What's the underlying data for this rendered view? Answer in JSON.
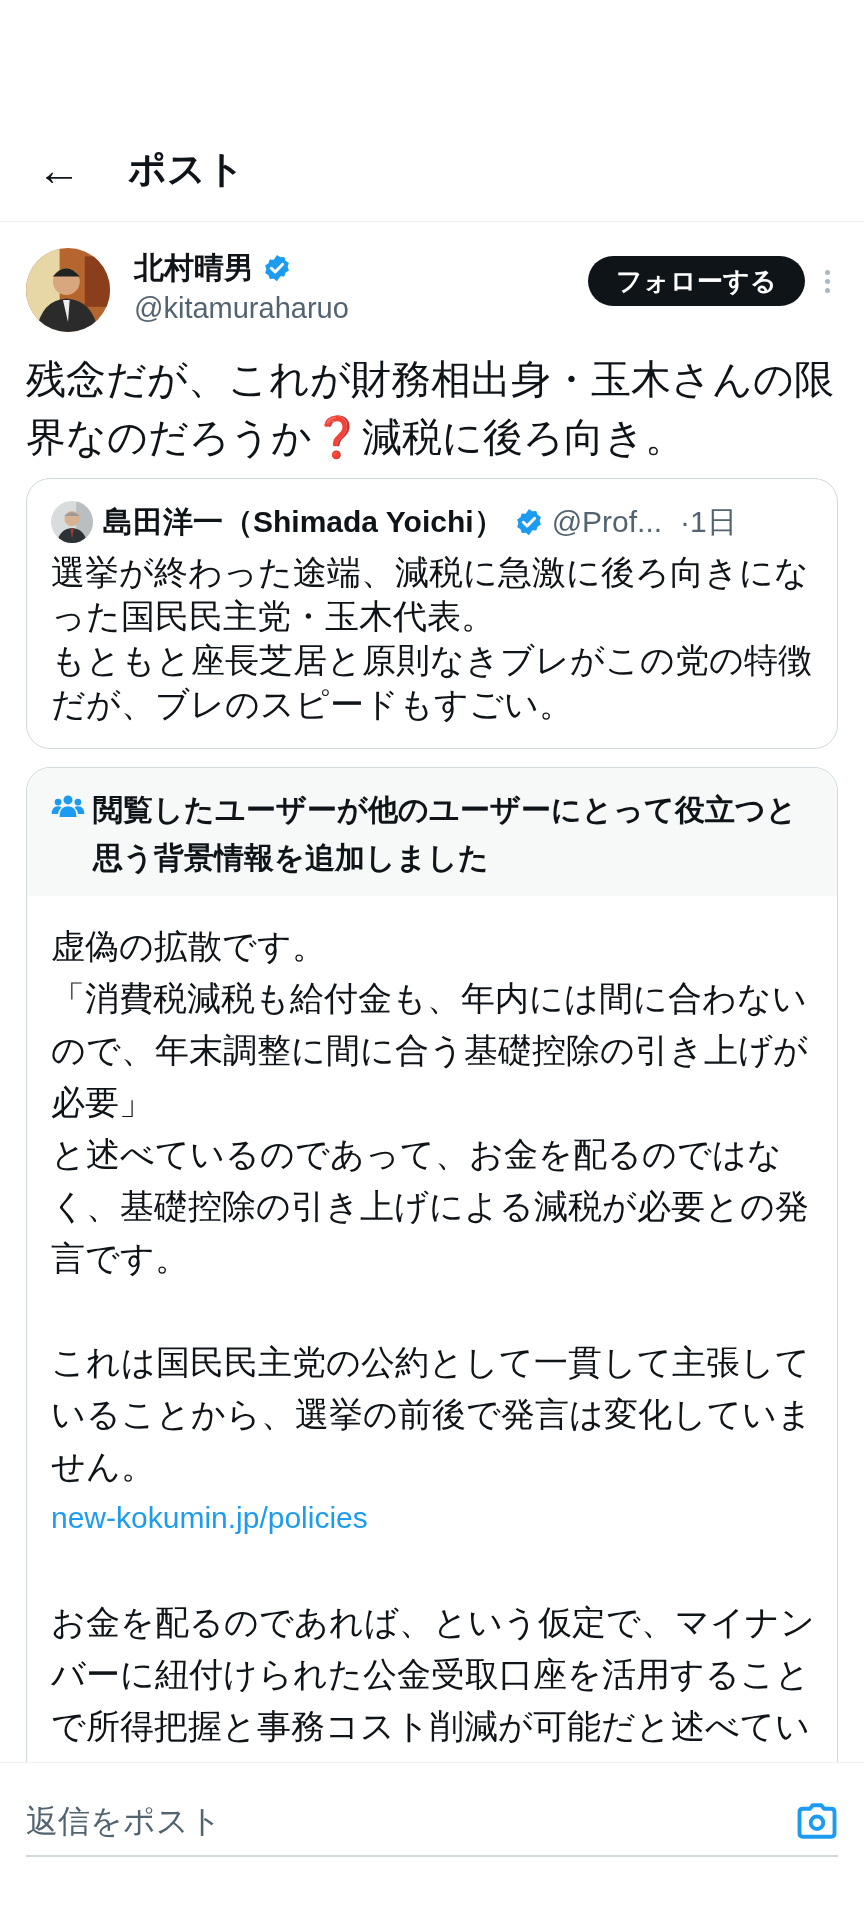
{
  "header": {
    "back": "←",
    "title": "ポスト"
  },
  "author": {
    "name": "北村晴男",
    "verified": true,
    "handle": "@kitamuraharuo",
    "follow_button": "フォローする"
  },
  "post_text": "残念だが、これが財務相出身・玉木さんの限界なのだろうか❓減税に後ろ向き。",
  "quote": {
    "name": "島田洋一（Shimada Yoichi）",
    "verified": true,
    "handle": "@Prof...",
    "time": "·1日",
    "lines": [
      "選挙が終わった途端、減税に急激に後ろ向きになった国民民主党・玉木代表。",
      "もともと座長芝居と原則なきブレがこの党の特徴だが、ブレのスピードもすごい。"
    ]
  },
  "community_note": {
    "title": "閲覧したユーザーが他のユーザーにとって役立つと思う背景情報を追加しました",
    "paragraphs": [
      {
        "lines": [
          "虚偽の拡散です。",
          "「消費税減税も給付金も、年内には間に合わないので、年末調整に間に合う基礎控除の引き上げが必要」",
          "と述べているのであって、お金を配るのではなく、基礎控除の引き上げによる減税が必要との発言です。"
        ]
      },
      {
        "lines": [
          "これは国民民主党の公約として一貫して主張していることから、選挙の前後で発言は変化していません。"
        ],
        "link": "new-kokumin.jp/policies"
      },
      {
        "lines": [
          "お金を配るのであれば、という仮定で、マイナンバーに紐付けられた公金受取口座を活用することで所得把握と事務コスト削減が可能だと述べてい"
        ]
      }
    ]
  },
  "reply_bar": {
    "placeholder": "返信をポスト"
  }
}
